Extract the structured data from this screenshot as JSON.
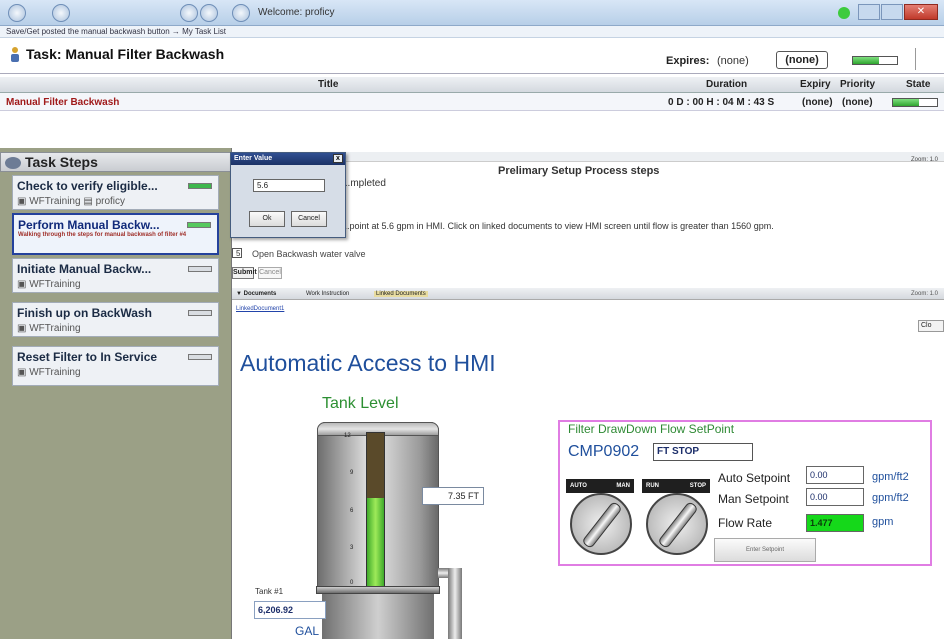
{
  "window": {
    "title": "Welcome: proficy",
    "breadcrumb": "Save/Get posted the manual backwash button → My Task List"
  },
  "task_header": {
    "title": "Task: Manual Filter Backwash",
    "expires_label": "Expires:",
    "expires_value": "(none)",
    "status_box": "(none)",
    "progress": 0.6
  },
  "table": {
    "columns": [
      "Title",
      "Duration",
      "Expiry",
      "Priority",
      "State"
    ],
    "rows": [
      {
        "title": "Manual Filter Backwash",
        "duration": "0 D : 00 H : 04 M : 43 S",
        "expiry": "(none)",
        "priority": "(none)",
        "progress": 0.6
      }
    ]
  },
  "steps_panel": {
    "header": "Task Steps",
    "steps": [
      {
        "title": "Check to verify eligible...",
        "sub1": "WFTraining",
        "sub2": "proficy",
        "done": true
      },
      {
        "title": "Perform Manual Backw...",
        "desc": "Walking through the steps for manual backwash of filter #4",
        "active": true
      },
      {
        "title": "Initiate Manual Backw...",
        "sub1": "WFTraining"
      },
      {
        "title": "Finish up on BackWash",
        "sub1": "WFTraining"
      },
      {
        "title": "Reset Filter to In Service",
        "sub1": "WFTraining"
      }
    ]
  },
  "process": {
    "title": "Prelimary Setup Process steps",
    "completed": "...mpleted",
    "setpoint_text": "...point at 5.6 gpm in HMI.  Click on linked documents to view HMI screen until flow is greater than 1560 gpm.",
    "checkbox_num": "5",
    "checkbox_label": "Open Backwash water valve",
    "submit": "Submit",
    "cancel": "Cancel",
    "zoom": "Zoom: 1.0"
  },
  "enter_value_dialog": {
    "title": "Enter Value",
    "value": "5.6",
    "ok": "Ok",
    "cancel": "Cancel",
    "close": "x"
  },
  "documents_bar": {
    "documents": "▼ Documents",
    "work_instruction": "Work Instruction",
    "linked_documents": "Linked Documents",
    "zoom": "Zoom: 1.0",
    "linked_doc_link": "LinkedDocument1",
    "close": "Clo"
  },
  "hmi": {
    "title": "Automatic Access to HMI",
    "tank": {
      "title": "Tank Level",
      "level": "7.35 FT",
      "level_fraction": 0.58,
      "ticks": [
        "12",
        "9",
        "6",
        "3",
        "0"
      ],
      "tank_label": "Tank #1",
      "volume": "6,206.92",
      "unit": "GAL"
    },
    "flow_panel": {
      "title": "Filter DrawDown Flow SetPoint",
      "code": "CMP0902",
      "status": "FT STOP",
      "switch1": {
        "left": "AUTO",
        "right": "MAN"
      },
      "switch2": {
        "left": "RUN",
        "right": "STOP"
      },
      "auto_setpoint_label": "Auto Setpoint",
      "auto_setpoint_value": "0.00",
      "auto_setpoint_unit": "gpm/ft2",
      "man_setpoint_label": "Man Setpoint",
      "man_setpoint_value": "0.00",
      "man_setpoint_unit": "gpm/ft2",
      "flow_rate_label": "Flow Rate",
      "flow_rate_value": "1.477",
      "flow_rate_unit": "gpm",
      "enter_setpoint": "Enter Setpoint"
    }
  }
}
